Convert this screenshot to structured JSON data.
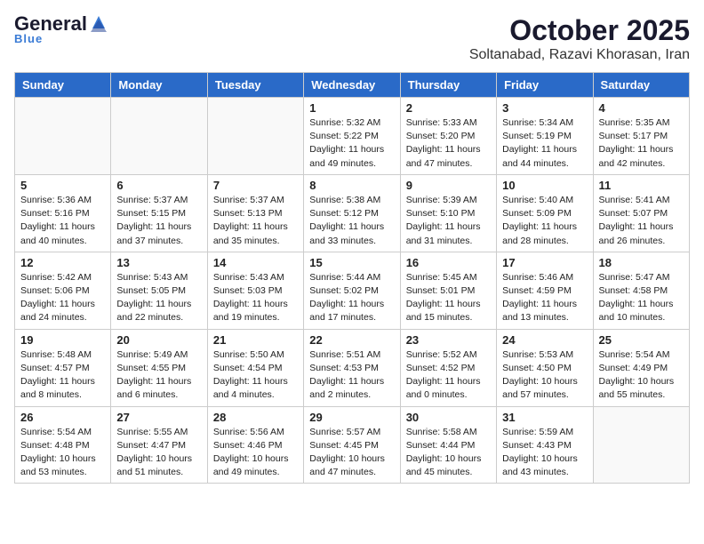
{
  "header": {
    "logo_general": "General",
    "logo_blue": "Blue",
    "month": "October 2025",
    "location": "Soltanabad, Razavi Khorasan, Iran"
  },
  "weekdays": [
    "Sunday",
    "Monday",
    "Tuesday",
    "Wednesday",
    "Thursday",
    "Friday",
    "Saturday"
  ],
  "weeks": [
    [
      {
        "day": "",
        "info": ""
      },
      {
        "day": "",
        "info": ""
      },
      {
        "day": "",
        "info": ""
      },
      {
        "day": "1",
        "info": "Sunrise: 5:32 AM\nSunset: 5:22 PM\nDaylight: 11 hours\nand 49 minutes."
      },
      {
        "day": "2",
        "info": "Sunrise: 5:33 AM\nSunset: 5:20 PM\nDaylight: 11 hours\nand 47 minutes."
      },
      {
        "day": "3",
        "info": "Sunrise: 5:34 AM\nSunset: 5:19 PM\nDaylight: 11 hours\nand 44 minutes."
      },
      {
        "day": "4",
        "info": "Sunrise: 5:35 AM\nSunset: 5:17 PM\nDaylight: 11 hours\nand 42 minutes."
      }
    ],
    [
      {
        "day": "5",
        "info": "Sunrise: 5:36 AM\nSunset: 5:16 PM\nDaylight: 11 hours\nand 40 minutes."
      },
      {
        "day": "6",
        "info": "Sunrise: 5:37 AM\nSunset: 5:15 PM\nDaylight: 11 hours\nand 37 minutes."
      },
      {
        "day": "7",
        "info": "Sunrise: 5:37 AM\nSunset: 5:13 PM\nDaylight: 11 hours\nand 35 minutes."
      },
      {
        "day": "8",
        "info": "Sunrise: 5:38 AM\nSunset: 5:12 PM\nDaylight: 11 hours\nand 33 minutes."
      },
      {
        "day": "9",
        "info": "Sunrise: 5:39 AM\nSunset: 5:10 PM\nDaylight: 11 hours\nand 31 minutes."
      },
      {
        "day": "10",
        "info": "Sunrise: 5:40 AM\nSunset: 5:09 PM\nDaylight: 11 hours\nand 28 minutes."
      },
      {
        "day": "11",
        "info": "Sunrise: 5:41 AM\nSunset: 5:07 PM\nDaylight: 11 hours\nand 26 minutes."
      }
    ],
    [
      {
        "day": "12",
        "info": "Sunrise: 5:42 AM\nSunset: 5:06 PM\nDaylight: 11 hours\nand 24 minutes."
      },
      {
        "day": "13",
        "info": "Sunrise: 5:43 AM\nSunset: 5:05 PM\nDaylight: 11 hours\nand 22 minutes."
      },
      {
        "day": "14",
        "info": "Sunrise: 5:43 AM\nSunset: 5:03 PM\nDaylight: 11 hours\nand 19 minutes."
      },
      {
        "day": "15",
        "info": "Sunrise: 5:44 AM\nSunset: 5:02 PM\nDaylight: 11 hours\nand 17 minutes."
      },
      {
        "day": "16",
        "info": "Sunrise: 5:45 AM\nSunset: 5:01 PM\nDaylight: 11 hours\nand 15 minutes."
      },
      {
        "day": "17",
        "info": "Sunrise: 5:46 AM\nSunset: 4:59 PM\nDaylight: 11 hours\nand 13 minutes."
      },
      {
        "day": "18",
        "info": "Sunrise: 5:47 AM\nSunset: 4:58 PM\nDaylight: 11 hours\nand 10 minutes."
      }
    ],
    [
      {
        "day": "19",
        "info": "Sunrise: 5:48 AM\nSunset: 4:57 PM\nDaylight: 11 hours\nand 8 minutes."
      },
      {
        "day": "20",
        "info": "Sunrise: 5:49 AM\nSunset: 4:55 PM\nDaylight: 11 hours\nand 6 minutes."
      },
      {
        "day": "21",
        "info": "Sunrise: 5:50 AM\nSunset: 4:54 PM\nDaylight: 11 hours\nand 4 minutes."
      },
      {
        "day": "22",
        "info": "Sunrise: 5:51 AM\nSunset: 4:53 PM\nDaylight: 11 hours\nand 2 minutes."
      },
      {
        "day": "23",
        "info": "Sunrise: 5:52 AM\nSunset: 4:52 PM\nDaylight: 11 hours\nand 0 minutes."
      },
      {
        "day": "24",
        "info": "Sunrise: 5:53 AM\nSunset: 4:50 PM\nDaylight: 10 hours\nand 57 minutes."
      },
      {
        "day": "25",
        "info": "Sunrise: 5:54 AM\nSunset: 4:49 PM\nDaylight: 10 hours\nand 55 minutes."
      }
    ],
    [
      {
        "day": "26",
        "info": "Sunrise: 5:54 AM\nSunset: 4:48 PM\nDaylight: 10 hours\nand 53 minutes."
      },
      {
        "day": "27",
        "info": "Sunrise: 5:55 AM\nSunset: 4:47 PM\nDaylight: 10 hours\nand 51 minutes."
      },
      {
        "day": "28",
        "info": "Sunrise: 5:56 AM\nSunset: 4:46 PM\nDaylight: 10 hours\nand 49 minutes."
      },
      {
        "day": "29",
        "info": "Sunrise: 5:57 AM\nSunset: 4:45 PM\nDaylight: 10 hours\nand 47 minutes."
      },
      {
        "day": "30",
        "info": "Sunrise: 5:58 AM\nSunset: 4:44 PM\nDaylight: 10 hours\nand 45 minutes."
      },
      {
        "day": "31",
        "info": "Sunrise: 5:59 AM\nSunset: 4:43 PM\nDaylight: 10 hours\nand 43 minutes."
      },
      {
        "day": "",
        "info": ""
      }
    ]
  ]
}
